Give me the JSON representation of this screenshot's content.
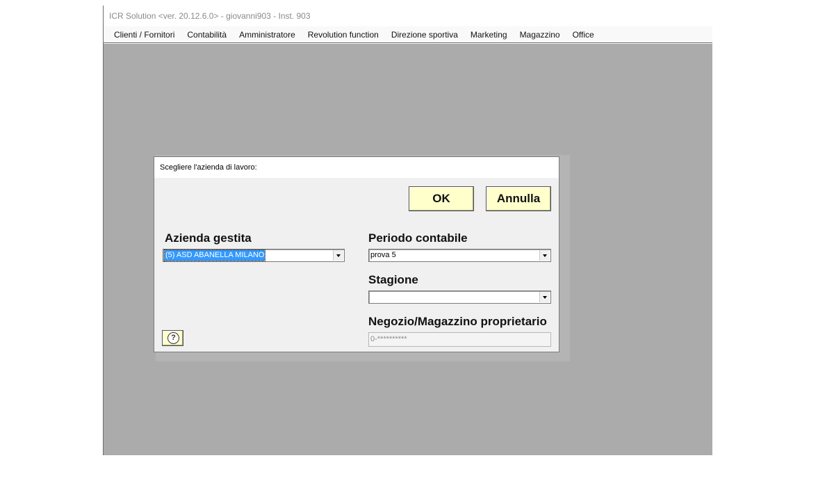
{
  "window": {
    "title": "ICR Solution <ver. 20.12.6.0>  -  giovanni903  -  Inst. 903"
  },
  "menu": {
    "items": [
      {
        "label": "Clienti / Fornitori"
      },
      {
        "label": "Contabilità"
      },
      {
        "label": "Amministratore"
      },
      {
        "label": "Revolution function"
      },
      {
        "label": "Direzione sportiva"
      },
      {
        "label": "Marketing"
      },
      {
        "label": "Magazzino"
      },
      {
        "label": "Office"
      }
    ]
  },
  "dialog": {
    "title": "Scegliere l'azienda di lavoro:",
    "ok_label": "OK",
    "cancel_label": "Annulla",
    "help_icon": "question-circle-icon",
    "azienda": {
      "label": "Azienda gestita",
      "value": "(5) ASD ABANELLA MILANO"
    },
    "periodo": {
      "label": "Periodo contabile",
      "value": "prova 5"
    },
    "stagione": {
      "label": "Stagione",
      "value": ""
    },
    "negozio": {
      "label": "Negozio/Magazzino proprietario",
      "value": "0-**********"
    }
  },
  "colors": {
    "workspace": "#ababab",
    "button_face": "#ffffcc",
    "selection": "#3399ff"
  }
}
